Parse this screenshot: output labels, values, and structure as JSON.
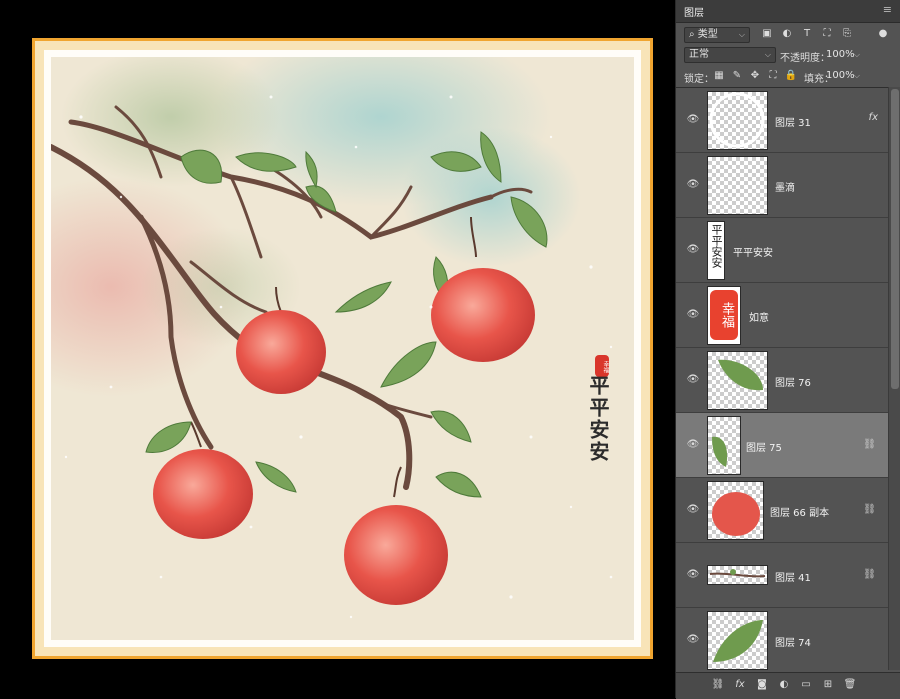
{
  "artwork": {
    "blessing_text": "平平安安",
    "seal_text": "幸福"
  },
  "panel": {
    "title": "图层",
    "menu_icon": "hamburger-icon",
    "filter": {
      "label": "⌕ 类型",
      "icons": [
        "image-filter-icon",
        "adjustment-filter-icon",
        "text-filter-icon",
        "shape-filter-icon",
        "smart-object-filter-icon"
      ]
    },
    "blend_mode": "正常",
    "opacity_label": "不透明度：",
    "opacity_value": "100%",
    "lock_label": "锁定：",
    "fill_label": "填充：",
    "fill_value": "100%",
    "lock_icons": [
      "lock-transparent-icon",
      "lock-image-icon",
      "lock-position-icon",
      "lock-artboard-icon",
      "lock-all-icon"
    ]
  },
  "layers": [
    {
      "name": "图层 31",
      "thumb": "circle",
      "badge": "fx",
      "selected": false
    },
    {
      "name": "墨滴",
      "thumb": "empty",
      "badge": "",
      "selected": false
    },
    {
      "name": "平平安安",
      "thumb": "text",
      "thumb_text": "平平安安",
      "badge": "",
      "selected": false
    },
    {
      "name": "如意",
      "thumb": "seal",
      "thumb_text": "幸福",
      "badge": "",
      "selected": false
    },
    {
      "name": "图层 76",
      "thumb": "leaf",
      "badge": "",
      "selected": false
    },
    {
      "name": "图层 75",
      "thumb": "leaf-small",
      "badge": "link",
      "selected": true
    },
    {
      "name": "图层 66 副本",
      "thumb": "apple",
      "badge": "link",
      "selected": false
    },
    {
      "name": "图层 41",
      "thumb": "branch",
      "badge": "link",
      "selected": false
    },
    {
      "name": "图层 74",
      "thumb": "leaf",
      "badge": "",
      "selected": false
    }
  ],
  "bottom_icons": [
    "link-layers-icon",
    "fx-icon",
    "mask-icon",
    "adjustment-icon",
    "group-folder-icon",
    "new-layer-icon",
    "trash-icon"
  ]
}
